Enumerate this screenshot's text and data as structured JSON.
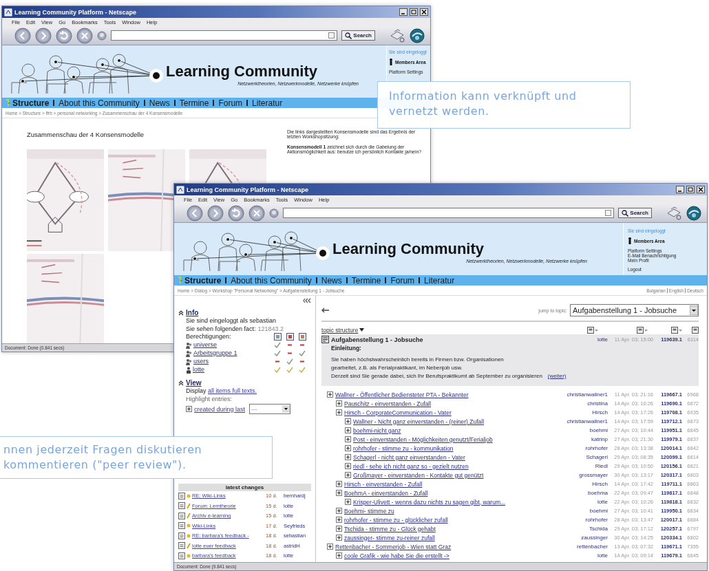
{
  "back_window": {
    "title": "Learning Community Platform - Netscape",
    "menu": [
      "File",
      "Edit",
      "View",
      "Go",
      "Bookmarks",
      "Tools",
      "Window",
      "Help"
    ],
    "search_button": "Search",
    "site": {
      "logo_title": "Learning Community",
      "tagline": "Netzwerktheorien, Netzwerkmodelle, Netzwerke knüpfen",
      "login_status": "Sie sind eingeloggt",
      "members_area": "Members Area",
      "member_links": [
        "Platform Settings"
      ]
    },
    "nav": [
      {
        "label": "Structure",
        "selected": true
      },
      {
        "label": "About this Community",
        "selected": false
      },
      {
        "label": "News",
        "selected": false
      },
      {
        "label": "Termine",
        "selected": false
      },
      {
        "label": "Forum",
        "selected": false
      },
      {
        "label": "Literatur",
        "selected": false
      }
    ],
    "breadcrumb": "Home > Structure > ffrb > personal networking > Zusammenschau der 4 Konsensmodelle",
    "heading": "Zusammenschau der 4 Konsensmodelle",
    "pictures": [
      {
        "kind": "picture"
      },
      {
        "kind": "picture"
      },
      {
        "kind": "picture"
      },
      {
        "kind": "picture"
      }
    ],
    "description": [
      "Die links dargestellten Konsensmodelle sind das Ergebnis der letzten Workshopsitzung:",
      "**Konsensmodell 1** zeichnet sich durch die Gabelung der Aktionsmöglichkeit aus: benutze ich persönlich Kontakte ja/nein?"
    ],
    "status_bar": "Document: Done (0.841 secs)"
  },
  "front_window": {
    "title": "Learning Community Platform - Netscape",
    "menu": [
      "File",
      "Edit",
      "View",
      "Go",
      "Bookmarks",
      "Tools",
      "Window",
      "Help"
    ],
    "search_button": "Search",
    "site": {
      "logo_title": "Learning Community",
      "tagline": "Netzwerktheorien, Netzwerkmodelle, Netzwerke knüpfen",
      "login_status": "Sie sind eingeloggt",
      "members_area": "Members Area",
      "member_links": [
        "Platform Settings",
        "E-Mail Benachrichtigung",
        "Mein Profil"
      ],
      "logout": "Logout"
    },
    "nav": [
      {
        "label": "Structure",
        "selected": true
      },
      {
        "label": "About this Community",
        "selected": false
      },
      {
        "label": "News",
        "selected": false
      },
      {
        "label": "Termine",
        "selected": false
      },
      {
        "label": "Forum",
        "selected": false
      },
      {
        "label": "Literatur",
        "selected": false
      }
    ],
    "breadcrumb": "Home > Dialog > Workshop \"Personal Networking\" > Aufgabenstellung 1 - Jobsuche",
    "languages": [
      "Bulgarian",
      "English",
      "Deutsch"
    ],
    "info": {
      "title": "Info",
      "login_line": "Sie sind eingeloggt als sebastian",
      "fact_label": "Sie sehen folgenden fact:",
      "fact_value": "121843.2",
      "rights_label": "Berechtigungen:",
      "groups": [
        {
          "name": "universe",
          "kind": "group",
          "rights": [
            true,
            false,
            false
          ]
        },
        {
          "name": "Arbeitsgruppe 1",
          "kind": "group",
          "rights": [
            true,
            false,
            true
          ]
        },
        {
          "name": "users",
          "kind": "group",
          "rights": [
            false,
            true,
            false
          ]
        },
        {
          "name": "lotte",
          "kind": "user",
          "rights": [
            true,
            true,
            true
          ]
        }
      ]
    },
    "view": {
      "title": "View",
      "display_prefix": "Display",
      "display_link": "all items full texts.",
      "highlight_label": "Highlight entries:",
      "created_link": "created during last",
      "period_select": "---"
    },
    "latest_changes": {
      "title": "latest changes",
      "items": [
        {
          "kind": "reply",
          "title": "RE: Wiki-Links",
          "age": "10 d.",
          "user": "bernhardj"
        },
        {
          "kind": "forum",
          "title": "Forum: Lerntheorie",
          "age": "15 d.",
          "user": "lotte"
        },
        {
          "kind": "archive",
          "title": "Archiv e-learning",
          "age": "15 d.",
          "user": "lotte"
        },
        {
          "kind": "reply",
          "title": "Wiki-Links",
          "age": "17 d.",
          "user": "Seyfrieds"
        },
        {
          "kind": "reply",
          "title": "RE: barbara's feedback -",
          "age": "18 d.",
          "user": "sebastian"
        },
        {
          "kind": "forum",
          "title": "lotte euer feedback",
          "age": "18 d.",
          "user": "astridH"
        },
        {
          "kind": "reply",
          "title": "barbara's feedback",
          "age": "18 d.",
          "user": "lotte"
        }
      ]
    },
    "topic": {
      "jump_label": "jump to topic:",
      "jump_select": "Aufgabenstellung 1 - Jobsuche",
      "structure_label": "topic structure",
      "root": {
        "title": "Aufgabenstellung 1 - Jobsuche",
        "author": "lotte",
        "date": "11 Apr. 03; 15:00",
        "id": "119639.1",
        "views": "6114",
        "intro_label": "Einleitung:",
        "intro_lines": [
          "Sie haben höchstwahrscheinlich bereits in Firmen bzw. Organisationen",
          "gearbeitet, z.B. als Ferialpraktikant, im Nebenjob usw.",
          "Derzeit sind Sie gerade dabei, sich Ihr Berufspraktikumt ab September zu organisieren"
        ],
        "more_link": "(weiter)"
      },
      "threads": [
        {
          "title": "Wallner - Öffentlicher Bediensteter PTA - Bekannter",
          "author": "christianwallner1",
          "date": "11 Apr. 03; 21:16",
          "id": "119667.1",
          "views": "6968",
          "children": [
            {
              "title": "Pauschitz - einverstanden - Zufall",
              "author": "christina",
              "date": "14 Apr. 03; 10:26",
              "id": "119690.1",
              "views": "6872"
            },
            {
              "title": "Hirsch - CorporateCommunication - Vater",
              "author": "Hirsch",
              "date": "14 Apr. 03; 17:26",
              "id": "119708.1",
              "views": "6935",
              "children": [
                {
                  "title": "Wallner - Nicht ganz einverstanden - (reiner) Zufall",
                  "author": "christianwallner1",
                  "date": "14 Apr. 03; 17:59",
                  "id": "119712.1",
                  "views": "6873"
                },
                {
                  "title": "boehmi-nicht ganz",
                  "author": "boehmi",
                  "date": "27 Apr. 03; 10:44",
                  "id": "119951.1",
                  "views": "6845"
                },
                {
                  "title": "Post - einverstanden - Möglichkeiten genutzt/Ferialjob",
                  "author": "katrinp",
                  "date": "27 Apr. 03; 21:30",
                  "id": "119979.1",
                  "views": "6837"
                },
                {
                  "title": "rohrhofer - stimme zu - kommunikation",
                  "author": "rohrhofer",
                  "date": "28 Apr. 03; 13:38",
                  "id": "120014.1",
                  "views": "6842"
                },
                {
                  "title": "Schagerl - nicht ganz einverstanden - Vater",
                  "author": "Schagerl",
                  "date": "29 Apr. 03; 08:35",
                  "id": "120099.1",
                  "views": "6814"
                },
                {
                  "title": "riedl - sehe ich nicht ganz so - gezielt nutzen",
                  "author": "Riedl",
                  "date": "29 Apr. 03; 10:50",
                  "id": "120156.1",
                  "views": "6821"
                },
                {
                  "title": "Großmayer - einverstanden - Kontakte gut genützt",
                  "author": "grossmayer",
                  "date": "30 Apr. 03; 13:17",
                  "id": "120317.1",
                  "views": "6803"
                }
              ]
            },
            {
              "title": "Hirsch - einverstanden - Zufall",
              "author": "Hirsch",
              "date": "14 Apr. 03; 17:42",
              "id": "119711.1",
              "views": "6863"
            },
            {
              "title": "BoehmA - einverstanden - Zufall",
              "author": "boehma",
              "date": "22 Apr. 03; 09:47",
              "id": "119817.1",
              "views": "6848",
              "children": [
                {
                  "title": "Krisper-Ulivett - wenns dazu nichts zu sagen gibt, warum...",
                  "author": "lotte",
                  "date": "22 Apr. 03; 10:26",
                  "id": "119818.1",
                  "views": "6832"
                }
              ]
            },
            {
              "title": "Boehmi- stimme zu",
              "author": "boehmi",
              "date": "27 Apr. 03; 10:41",
              "id": "119950.1",
              "views": "6834"
            },
            {
              "title": "rohrhofer - stimme zu - glücklicher zufall",
              "author": "rohrhofer",
              "date": "28 Apr. 03; 13:47",
              "id": "120017.1",
              "views": "6884"
            },
            {
              "title": "Tschida - stimme zu - Glück gehabt",
              "author": "Tschida",
              "date": "29 Apr. 03; 17:12",
              "id": "120257.1",
              "views": "6797"
            },
            {
              "title": "zaussinger- stimme zu-reiner zufall",
              "author": "zaussinger",
              "date": "30 Apr. 03; 14:25",
              "id": "120334.1",
              "views": "6802"
            }
          ]
        },
        {
          "title": "Rettenbacher - Sommerjob - Wien statt Graz",
          "author": "rettenbacher",
          "date": "13 Apr. 03; 07:32",
          "id": "119671.1",
          "views": "7355",
          "children": [
            {
              "title": "coole Grafik - wie habe Sie die erstellt ->",
              "author": "lotte",
              "date": "14 Apr. 03; 09:14",
              "id": "119679.1",
              "views": "6845"
            }
          ]
        }
      ]
    },
    "status_bar": "Document: Done (9.841 secs)"
  },
  "callouts": [
    {
      "lines": [
        "Information kann verknüpft und",
        "vernetzt werden."
      ]
    },
    {
      "lines": [
        "nnen jederzeit Fragen diskutieren",
        "kommentieren (\"peer review\")."
      ]
    }
  ]
}
